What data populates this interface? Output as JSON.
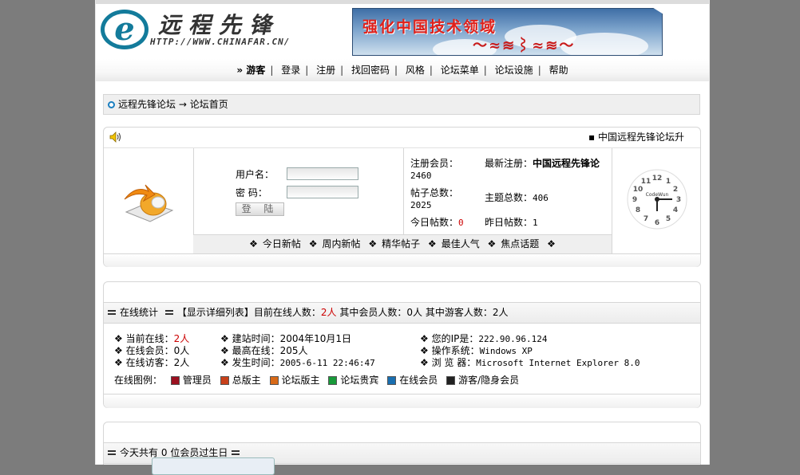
{
  "header": {
    "logo_text": "远程先锋",
    "logo_url": "HTTP://WWW.CHINAFAR.CN/",
    "banner_slogan": "强化中国技术领域"
  },
  "nav": {
    "guest": "» 游客",
    "items": [
      "登录",
      "注册",
      "找回密码",
      "风格",
      "论坛菜单",
      "论坛设施",
      "帮助"
    ]
  },
  "breadcrumb": {
    "forum": "远程先锋论坛",
    "arrow": "→",
    "page": "论坛首页"
  },
  "announcement": {
    "text": "▪ 中国远程先锋论坛升"
  },
  "login": {
    "username_label": "用户名：",
    "password_label": "密  码：",
    "submit_label": "登 陆"
  },
  "stats": {
    "members_label": "注册会员：",
    "members": "2460",
    "newest_label": "最新注册：",
    "newest": "中国远程先锋论",
    "posts_label": "帖子总数：",
    "posts": "2025",
    "topics_label": "主题总数：",
    "topics": "406",
    "today_label": "今日帖数：",
    "today": "0",
    "yesterday_label": "昨日帖数：",
    "yesterday": "1"
  },
  "quick_links": [
    "今日新帖",
    "周内新帖",
    "精华帖子",
    "最佳人气",
    "焦点话题"
  ],
  "online": {
    "title": "在线统计",
    "detail_link": "【显示详细列表】",
    "now_label": "目前在线人数：",
    "now_value": "2人",
    "members_label": "其中会员人数：",
    "members_value": "0人",
    "guests_label": "其中游客人数：",
    "guests_value": "2人",
    "rows": {
      "current_label": "当前在线：",
      "current": "2人",
      "online_members_label": "在线会员：",
      "online_members": "0人",
      "online_guests_label": "在线访客：",
      "online_guests": "2人",
      "founded_label": "建站时间：",
      "founded": "2004年10月1日",
      "peak_label": "最高在线：",
      "peak": "205人",
      "peak_time_label": "发生时间：",
      "peak_time": "2005-6-11 22:46:47",
      "ip_label": "您的IP是：",
      "ip": "222.90.96.124",
      "os_label": "操作系统：",
      "os": "Windows XP",
      "browser_label": "浏 览 器：",
      "browser": "Microsoft Internet Explorer 8.0"
    },
    "legend_label": "在线图例：",
    "legend": [
      {
        "label": "管理员",
        "color": "#9b1020"
      },
      {
        "label": "总版主",
        "color": "#c8401a"
      },
      {
        "label": "论坛版主",
        "color": "#d86a18"
      },
      {
        "label": "论坛贵宾",
        "color": "#189a3a"
      },
      {
        "label": "在线会员",
        "color": "#1a6fb0"
      },
      {
        "label": "游客/隐身会员",
        "color": "#222222"
      }
    ]
  },
  "birthday": {
    "prefix": "今天共有",
    "count": "0",
    "suffix": "位会员过生日"
  }
}
